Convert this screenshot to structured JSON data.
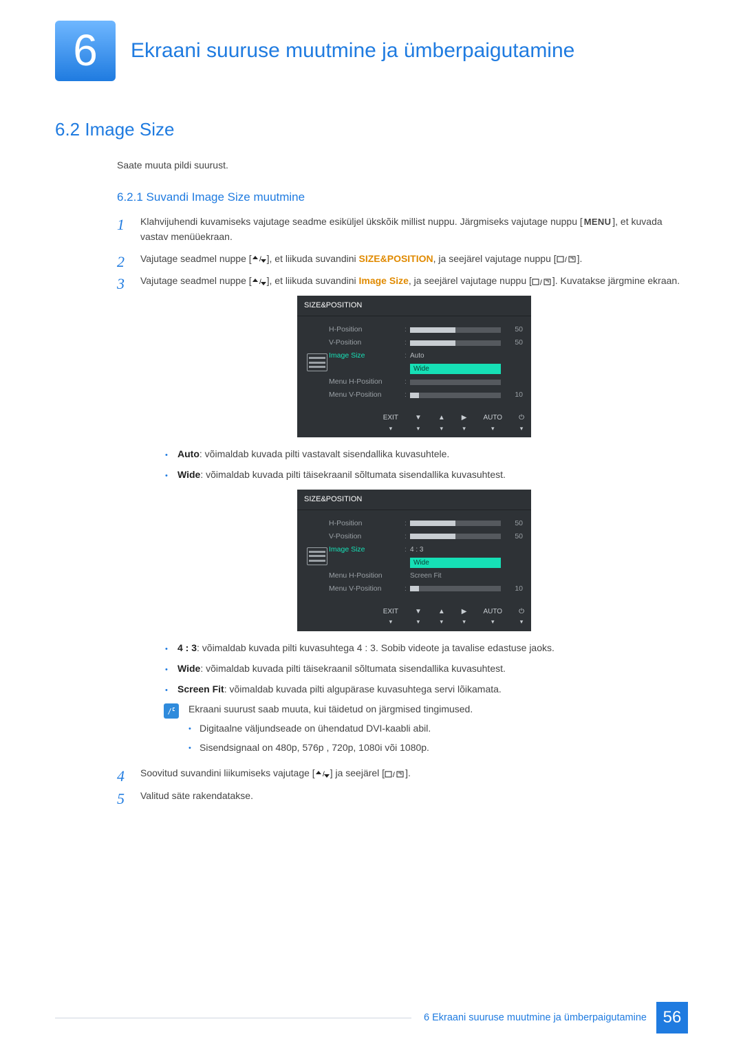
{
  "chapter": {
    "num": "6",
    "title": "Ekraani suuruse muutmine ja ümberpaigutamine"
  },
  "section": {
    "title": "6.2   Image Size",
    "intro": "Saate muuta pildi suurust.",
    "subsection_title": "6.2.1   Suvandi Image Size muutmine"
  },
  "keys": {
    "menu": "MENU"
  },
  "text": {
    "size_position": "SIZE&POSITION",
    "image_size": "Image Size",
    "auto": "Auto",
    "wide": "Wide",
    "four_three": "4 : 3",
    "screen_fit": "Screen Fit"
  },
  "steps": {
    "s1a": "Klahvijuhendi kuvamiseks vajutage seadme esiküljel ükskõik millist nuppu. Järgmiseks vajutage nuppu [",
    "s1b": "], et kuvada vastav menüüekraan.",
    "s2a": "Vajutage seadmel nuppe [",
    "s2b": "], et liikuda suvandini ",
    "s2c": ", ja seejärel vajutage nuppu [",
    "s2d": "].",
    "s3a": "Vajutage seadmel nuppe [",
    "s3b": "], et liikuda suvandini ",
    "s3c": ", ja seejärel vajutage nuppu [",
    "s3d": "]. Kuvatakse järgmine ekraan.",
    "s4a": "Soovitud suvandini liikumiseks vajutage [",
    "s4b": "] ja seejärel [",
    "s4c": "].",
    "s5": "Valitud säte rakendatakse."
  },
  "bullets1": {
    "auto": ": võimaldab kuvada pilti vastavalt sisendallika kuvasuhtele.",
    "wide": ": võimaldab kuvada pilti täisekraanil sõltumata sisendallika kuvasuhtest."
  },
  "bullets2": {
    "four_three": ": võimaldab kuvada pilti kuvasuhtega 4 : 3. Sobib videote ja tavalise edastuse jaoks.",
    "wide": ": võimaldab kuvada pilti täisekraanil sõltumata sisendallika kuvasuhtest.",
    "screen_fit": ": võimaldab kuvada pilti algupärase kuvasuhtega servi lõikamata."
  },
  "note": {
    "lead": "Ekraani suurust saab muuta, kui täidetud on järgmised tingimused.",
    "i1": "Digitaalne väljundseade on ühendatud DVI-kaabli abil.",
    "i2": "Sisendsignaal on 480p, 576p , 720p, 1080i või 1080p."
  },
  "osd": {
    "title": "SIZE&POSITION",
    "labels": {
      "hpos": "H-Position",
      "vpos": "V-Position",
      "imgsize": "Image Size",
      "mhpos": "Menu H-Position",
      "mvpos": "Menu V-Position"
    },
    "values": {
      "v50a": "50",
      "v50b": "50",
      "v10": "10"
    },
    "options1": {
      "o1": "Auto",
      "o2": "Wide"
    },
    "options2": {
      "o1": "4 : 3",
      "o2": "Wide",
      "o3": "Screen Fit"
    },
    "footer": {
      "exit": "EXIT",
      "auto": "AUTO"
    }
  },
  "footer": {
    "label": "6 Ekraani suuruse muutmine ja ümberpaigutamine",
    "page": "56"
  }
}
